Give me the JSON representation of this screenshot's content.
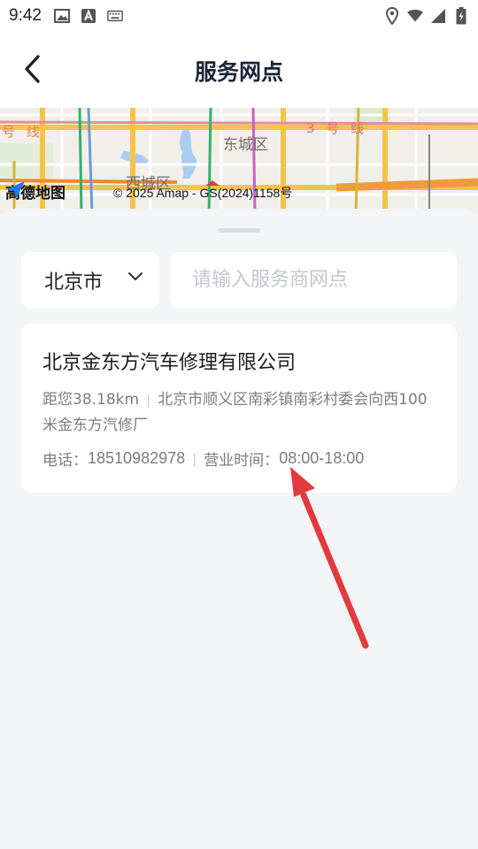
{
  "status_bar": {
    "time": "9:42"
  },
  "header": {
    "title": "服务网点"
  },
  "map": {
    "districts": [
      "东城区",
      "西城区"
    ],
    "line_labels": [
      "号 线",
      "3 号 线"
    ],
    "brand": "高德地图",
    "copyright": "© 2025 Amap - GS(2024)1158号"
  },
  "filters": {
    "city": "北京市",
    "search_placeholder": "请输入服务商网点",
    "search_value": ""
  },
  "results": [
    {
      "name": "北京金东方汽车修理有限公司",
      "distance": "距您38.18km",
      "address": "北京市顺义区南彩镇南彩村委会向西100米金东方汽修厂",
      "phone_label": "电话：",
      "phone": "18510982978",
      "hours_label": "营业时间：",
      "hours": "08:00-18:00"
    }
  ],
  "colors": {
    "annotation_arrow": "#e23a3e",
    "title": "#1c2238",
    "secondary_text": "#7a7c82"
  }
}
